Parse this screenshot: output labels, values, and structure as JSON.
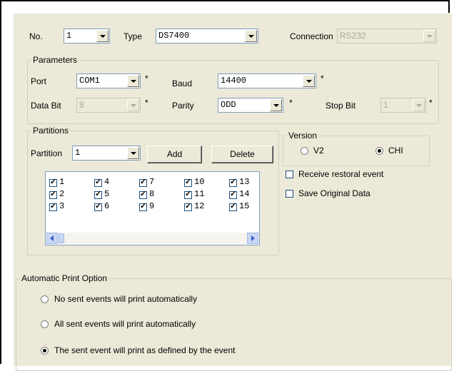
{
  "top": {
    "no_label": "No.",
    "no_value": "1",
    "type_label": "Type",
    "type_value": "DS7400",
    "connection_label": "Connection",
    "connection_value": "RS232"
  },
  "parameters": {
    "title": "Parameters",
    "port_label": "Port",
    "port_value": "COM1",
    "baud_label": "Baud",
    "baud_value": "14400",
    "databit_label": "Data Bit",
    "databit_value": "8",
    "parity_label": "Parity",
    "parity_value": "ODD",
    "stopbit_label": "Stop Bit",
    "stopbit_value": "1",
    "required_mark": "*"
  },
  "partitions": {
    "title": "Partitions",
    "partition_label": "Partition",
    "partition_value": "1",
    "add_label": "Add",
    "delete_label": "Delete",
    "items": [
      {
        "label": "1",
        "checked": true
      },
      {
        "label": "2",
        "checked": true
      },
      {
        "label": "3",
        "checked": true
      },
      {
        "label": "4",
        "checked": true
      },
      {
        "label": "5",
        "checked": true
      },
      {
        "label": "6",
        "checked": true
      },
      {
        "label": "7",
        "checked": true
      },
      {
        "label": "8",
        "checked": true
      },
      {
        "label": "9",
        "checked": true
      },
      {
        "label": "10",
        "checked": true
      },
      {
        "label": "11",
        "checked": true
      },
      {
        "label": "12",
        "checked": true
      },
      {
        "label": "13",
        "checked": true
      },
      {
        "label": "14",
        "checked": true
      },
      {
        "label": "15",
        "checked": true
      }
    ]
  },
  "version": {
    "title": "Version",
    "v2_label": "V2",
    "chi_label": "CHI",
    "selected": "CHI"
  },
  "options": {
    "receive_restoral_label": "Receive restoral event",
    "receive_restoral_checked": false,
    "save_original_label": "Save Original Data",
    "save_original_checked": false
  },
  "print_option": {
    "title": "Automatic Print Option",
    "options": [
      {
        "label": "No sent events will print automatically",
        "selected": false
      },
      {
        "label": "All sent events will print automatically",
        "selected": false
      },
      {
        "label": "The sent event will print as defined by the event",
        "selected": true
      }
    ]
  }
}
